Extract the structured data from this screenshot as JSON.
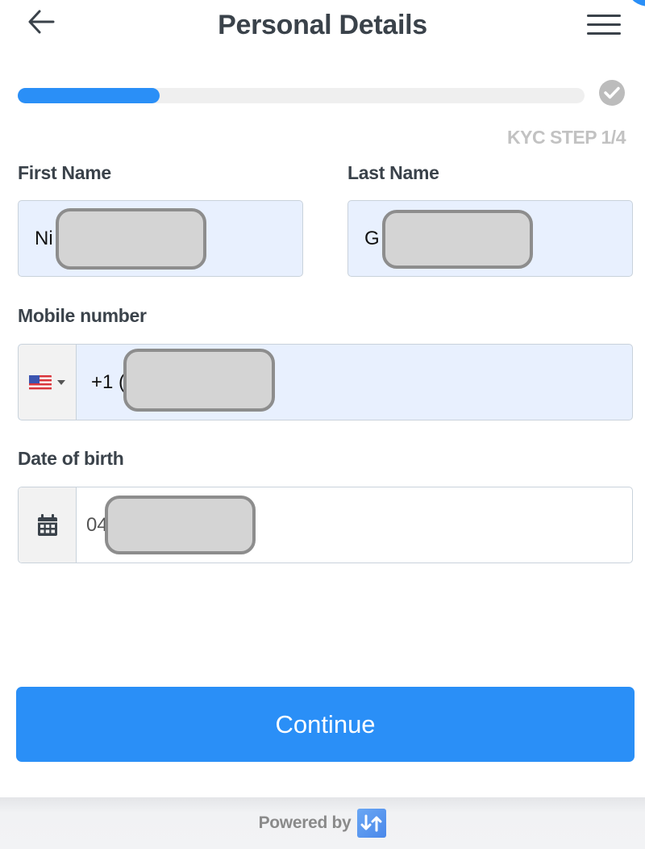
{
  "header": {
    "title": "Personal Details",
    "back_icon": "arrow-left-icon",
    "menu_icon": "hamburger-menu-icon"
  },
  "progress": {
    "value_percent": 25,
    "step_label": "KYC STEP 1/4",
    "complete_icon": "check-circle-icon"
  },
  "form": {
    "first_name": {
      "label": "First Name",
      "value": "Ni"
    },
    "last_name": {
      "label": "Last Name",
      "value": "G"
    },
    "mobile": {
      "label": "Mobile number",
      "country": "US",
      "country_icon": "us-flag-icon",
      "value": "+1 ("
    },
    "dob": {
      "label": "Date of birth",
      "icon": "calendar-icon",
      "value": "04"
    }
  },
  "actions": {
    "continue_label": "Continue"
  },
  "footer": {
    "powered_by": "Powered by",
    "logo_icon": "brand-logo-icon"
  },
  "colors": {
    "accent": "#2a8ff7",
    "text": "#3a424a",
    "input_fill": "#e8f0fe",
    "muted": "#c2c2c2"
  }
}
